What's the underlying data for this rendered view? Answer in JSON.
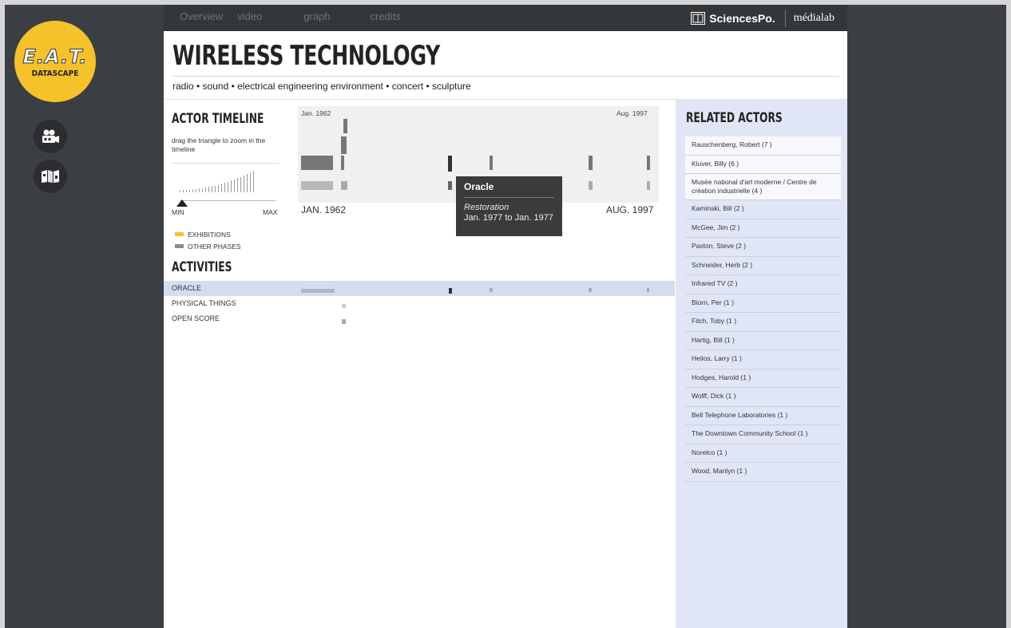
{
  "logo": {
    "main": "E.A.T.",
    "sub": "DATASCAPE"
  },
  "sidebar_icons": [
    "video-camera-icon",
    "map-book-icon"
  ],
  "nav": [
    "Overview",
    "video",
    "graph",
    "credits"
  ],
  "brand": {
    "sciencespo": "SciencesPo.",
    "medialab": "médialab"
  },
  "page": {
    "title": "WIRELESS TECHNOLOGY",
    "tags": "radio • sound • electrical engineering environment • concert • sculpture"
  },
  "timeline": {
    "section_title": "ACTOR TIMELINE",
    "hint": "drag the triangle to zoom in the timeline",
    "zoom_min": "MIN",
    "zoom_max": "MAX",
    "start_small": "Jan. 1962",
    "end_small": "Aug. 1997",
    "start_big": "JAN. 1962",
    "end_big": "AUG. 1997",
    "legend": [
      {
        "label": "EXHIBITIONS",
        "color": "#f5c22b"
      },
      {
        "label": "OTHER PHASES",
        "color": "#8c8c8c"
      }
    ],
    "tooltip": {
      "title": "Oracle",
      "phase": "Restoration",
      "dates": "Jan. 1977 to Jan. 1977"
    }
  },
  "activities": {
    "section_title": "ACTIVITIES",
    "items": [
      {
        "label": "ORACLE",
        "selected": true
      },
      {
        "label": "PHYSICAL THINGS",
        "selected": false
      },
      {
        "label": "OPEN SCORE",
        "selected": false
      }
    ]
  },
  "related": {
    "section_title": "RELATED ACTORS",
    "items": [
      "Rauschenberg, Robert (7 )",
      "Kluver, Billy (6 )",
      "Musée national d'art moderne / Centre de création industrielle (4 )",
      "Kaminski, Bill (2 )",
      "McGee, Jim (2 )",
      "Paxton, Steve (2 )",
      "Schneider, Herb (2 )",
      "Infrared TV (2 )",
      "Biorn, Per (1 )",
      "Fitch, Toby (1 )",
      "Hartig, Bill (1 )",
      "Heilos, Larry (1 )",
      "Hodges, Harold (1 )",
      "Wolff, Dick (1 )",
      "Bell Telephone Laboratories (1 )",
      "The Downtown Community School (1 )",
      "Norelco (1 )",
      "Wood, Marilyn (1 )"
    ]
  },
  "colors": {
    "accent_yellow": "#f5c22b",
    "dark": "#34373a",
    "related_bg": "#e1e6f7",
    "selected_row": "#d5dcf2"
  }
}
